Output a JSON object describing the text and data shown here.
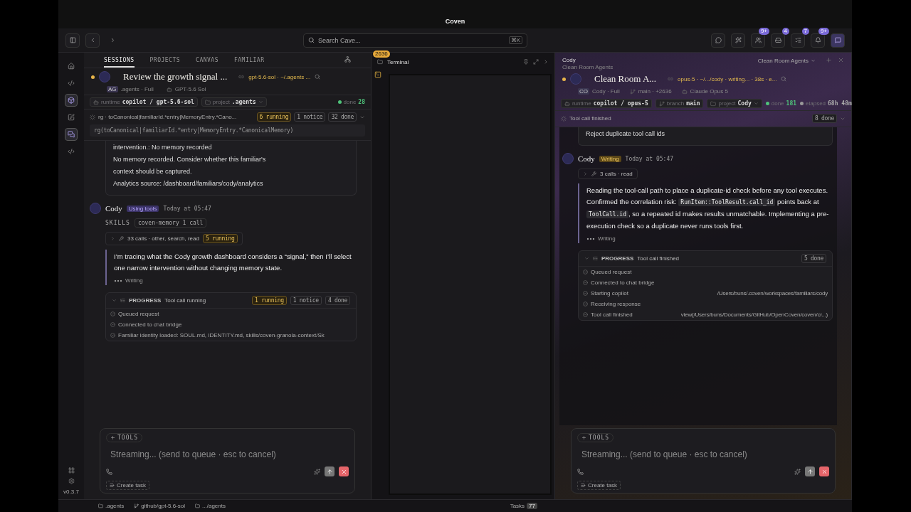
{
  "window": {
    "title": "Coven"
  },
  "toolbar": {
    "search_placeholder": "Search Cave...",
    "search_shortcut": "⌘K",
    "badges": [
      {
        "kind": "agents",
        "count": "9+"
      },
      {
        "kind": "inbox",
        "count": "4"
      },
      {
        "kind": "tasks",
        "count": "7"
      },
      {
        "kind": "bell",
        "count": "9+"
      }
    ]
  },
  "rail": {
    "items": [
      {
        "kind": "home",
        "selected": false
      },
      {
        "kind": "code",
        "selected": false
      },
      {
        "kind": "box",
        "selected": true
      },
      {
        "kind": "edit",
        "selected": false
      },
      {
        "kind": "chat",
        "selected": true
      },
      {
        "kind": "code",
        "selected": false
      }
    ],
    "version": "v0.3.7"
  },
  "left": {
    "tabs": [
      {
        "label": "SESSIONS",
        "selected": true
      },
      {
        "label": "PROJECTS",
        "selected": false
      },
      {
        "label": "CANVAS",
        "selected": false
      },
      {
        "label": "FAMILIAR",
        "selected": false
      }
    ],
    "session": {
      "title": "Review the growth signal ...",
      "meta": "gpt-5.6-sol · ~/.agents ...",
      "workspace_badge": "AG",
      "workspace": ".agents · Full",
      "model": "GPT-5.6 Sol"
    },
    "chips": [
      {
        "kind": "runtime",
        "label": "runtime",
        "value": "copilot / gpt-5.6-sol"
      },
      {
        "kind": "project",
        "label": "project",
        "value": ".agents"
      },
      {
        "kind": "done",
        "label": "done",
        "value": "28"
      }
    ],
    "activity": {
      "text": "rg · toCanonical|familiarId.*entry|MemoryEntry.*Cano...",
      "badges": [
        {
          "kind": "running",
          "text": "6 running"
        },
        {
          "kind": "plain",
          "text": "1 notice"
        },
        {
          "kind": "plain",
          "text": "32 done"
        }
      ],
      "command": "rg(toCanonical|familiarId.*entry|MemoryEntry.*CanonicalMemory)"
    },
    "prior_lines": [
      "intervention.: No memory recorded",
      "No memory recorded. Consider whether this familiar's",
      "context should be captured.",
      "Analytics source: /dashboard/familiars/cody/analytics"
    ],
    "message": {
      "kind": "tools",
      "author": "Cody",
      "status": "Using tools",
      "time": "Today at 05:47",
      "skills_label": "SKILLS",
      "skill": "coven-memory 1 call",
      "calls": "33 calls · other, search, read",
      "calls_badge": "5 running",
      "parts": [
        {
          "kind": "text",
          "text": "I’m tracing what the Cody growth dashboard considers a “signal,” then I’ll select one narrow intervention without changing memory state."
        }
      ],
      "writing": "Writing"
    },
    "progress": {
      "label": "PROGRESS",
      "status": "Tool call running",
      "badges": [
        {
          "kind": "running",
          "text": "1 running"
        },
        {
          "kind": "plain",
          "text": "1 notice"
        },
        {
          "kind": "plain",
          "text": "4 done"
        }
      ],
      "steps": [
        {
          "text": "Queued request"
        },
        {
          "text": "Connected to chat bridge"
        },
        {
          "text": "Familiar identity loaded: SOUL.md, IDENTITY.md, skills/coven-granola-context/Sk"
        }
      ]
    },
    "composer": {
      "tools": "TOOLS",
      "placeholder": "Streaming... (send to queue · esc to cancel)",
      "create_task": "Create task"
    }
  },
  "terminal": {
    "badge": "2636",
    "title": "Terminal"
  },
  "right": {
    "agent": "Cody",
    "team": "Clean Room Agents",
    "team_select": "Clean Room Agents",
    "session": {
      "title": "Clean Room A...",
      "meta": "opus-5 · ~/.../cody · writing... · 38s · e...",
      "workspace_badge": "CO",
      "workspace": "Cody · Full",
      "branch": "main · +2636",
      "model": "Claude Opus 5"
    },
    "chips": [
      {
        "kind": "runtime",
        "label": "runtime",
        "value": "copilot / opus-5"
      },
      {
        "kind": "branch",
        "label": "branch",
        "value": "main"
      },
      {
        "kind": "project",
        "label": "project",
        "value": "Cody"
      },
      {
        "kind": "done",
        "label": "done",
        "value": "181"
      },
      {
        "kind": "elapsed",
        "label": "elapsed",
        "value": "68h 48m"
      }
    ],
    "activity": {
      "text": "Tool call finished",
      "badges": [
        {
          "kind": "plain",
          "text": "8 done"
        }
      ]
    },
    "prior_lines": [
      "Reject duplicate tool call ids"
    ],
    "message": {
      "kind": "writing",
      "author": "Cody",
      "status": "Writing",
      "time": "Today at 05:47",
      "calls": "3 calls · read",
      "parts": [
        {
          "kind": "text",
          "text": "Reading the tool-call path to place a duplicate-id check before any tool executes. Confirmed the correlation risk: "
        },
        {
          "kind": "code",
          "text": "RunItem::ToolResult.call_id"
        },
        {
          "kind": "text",
          "text": " points back at "
        },
        {
          "kind": "code",
          "text": "ToolCall.id"
        },
        {
          "kind": "text",
          "text": ", so a repeated id makes results unmatchable. Implementing a pre-execution check so a duplicate never runs tools first."
        }
      ],
      "writing": "Writing"
    },
    "progress": {
      "label": "PROGRESS",
      "status": "Tool call finished",
      "badges": [
        {
          "kind": "plain",
          "text": "5 done"
        }
      ],
      "steps": [
        {
          "text": "Queued request"
        },
        {
          "text": "Connected to chat bridge"
        },
        {
          "text": "Starting copilot",
          "detail": "/Users/buns/.coven/workspaces/familiars/cody"
        },
        {
          "text": "Receiving response"
        },
        {
          "text": "Tool call finished",
          "detail": "view(/Users/buns/Documents/GitHub/OpenCoven/coven/cr...)"
        }
      ]
    },
    "composer": {
      "tools": "TOOLS",
      "placeholder": "Streaming... (send to queue · esc to cancel)",
      "create_task": "Create task"
    }
  },
  "footer": {
    "items": [
      {
        "kind": "folder",
        "text": ".agents"
      },
      {
        "kind": "branch",
        "text": "github/gpt-5.6-sol"
      },
      {
        "kind": "folder",
        "text": ".../agents"
      }
    ],
    "tasks_label": "Tasks",
    "tasks_count": "77"
  }
}
